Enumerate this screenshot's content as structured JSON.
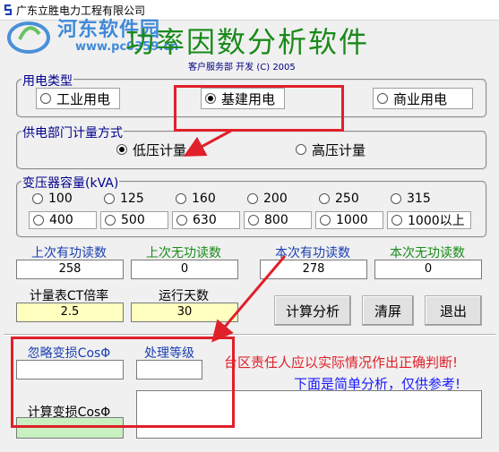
{
  "window": {
    "title": "广东立胜电力工程有限公司"
  },
  "watermark": {
    "text": "河东软件园",
    "url": "www.pc0359.cn"
  },
  "header": {
    "title": "功率因数分析软件",
    "credit": "客户服务部 开发 (C) 2005"
  },
  "electricity_type": {
    "label": "用电类型",
    "options": [
      "工业用电",
      "基建用电",
      "商业用电"
    ],
    "selected": "基建用电"
  },
  "metering": {
    "label": "供电部门计量方式",
    "options": [
      "低压计量",
      "高压计量"
    ],
    "selected": "低压计量"
  },
  "transformer": {
    "label": "变压器容量(kVA)",
    "options": [
      "100",
      "125",
      "160",
      "200",
      "250",
      "315",
      "400",
      "500",
      "630",
      "800",
      "1000",
      "1000以上"
    ]
  },
  "readings": {
    "last_active": {
      "label": "上次有功读数",
      "value": "258"
    },
    "last_reactive": {
      "label": "上次无功读数",
      "value": "0"
    },
    "this_active": {
      "label": "本次有功读数",
      "value": "278"
    },
    "this_reactive": {
      "label": "本次无功读数",
      "value": "0"
    }
  },
  "params": {
    "ct_ratio": {
      "label": "计量表CT倍率",
      "value": "2.5"
    },
    "run_days": {
      "label": "运行天数",
      "value": "30"
    }
  },
  "buttons": {
    "calc": "计算分析",
    "clear": "清屏",
    "exit": "退出"
  },
  "results": {
    "ignore_label": "忽略变损CosΦ",
    "ignore_value": "",
    "level_label": "处理等级",
    "level_value": "",
    "calc_label": "计算变损CosΦ",
    "calc_value": ""
  },
  "messages": {
    "warning": "台区责任人应以实际情况作出正确判断!",
    "note": "下面是简单分析，仅供参考!"
  },
  "colors": {
    "accent_red": "#e0202a",
    "title_green": "#1a8a1a",
    "label_blue": "#00008b",
    "watermark_blue": "#2d7fd6"
  }
}
